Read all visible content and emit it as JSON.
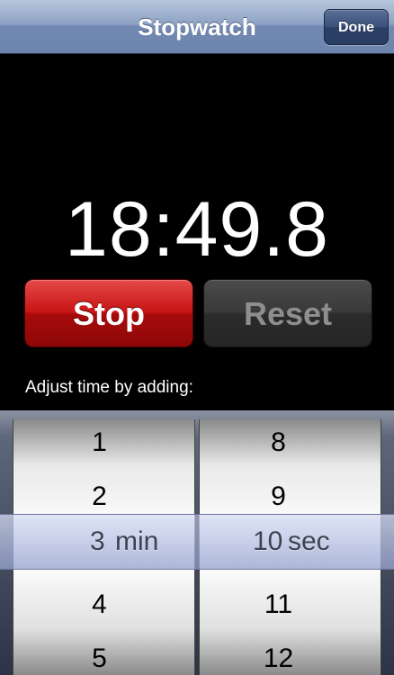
{
  "navbar": {
    "title": "Stopwatch",
    "done_label": "Done"
  },
  "timer": {
    "display": "18:49.8"
  },
  "buttons": {
    "stop_label": "Stop",
    "reset_label": "Reset"
  },
  "adjust": {
    "label": "Adjust time by adding:"
  },
  "picker": {
    "minutes": {
      "rows": [
        "1",
        "2",
        "4",
        "5"
      ],
      "selected_value": "3",
      "unit": "min"
    },
    "seconds": {
      "rows": [
        "8",
        "9",
        "11",
        "12"
      ],
      "selected_value": "10",
      "unit": "sec"
    }
  },
  "colors": {
    "stop_button": "#c81414",
    "reset_button": "#393939",
    "navbar": "#7289b1",
    "background": "#000000"
  }
}
